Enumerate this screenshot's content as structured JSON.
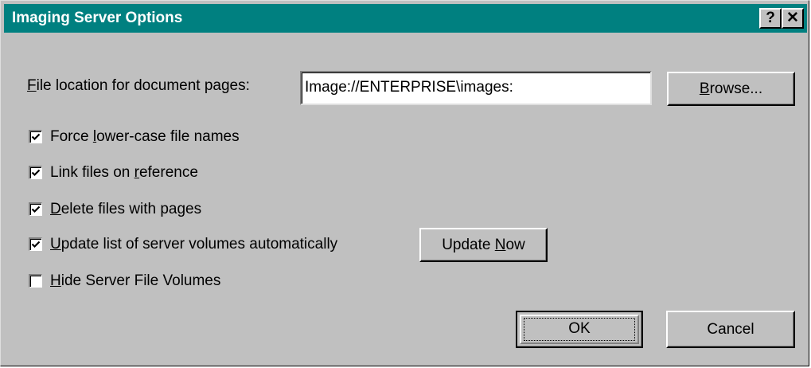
{
  "window": {
    "title": "Imaging Server Options",
    "help_glyph": "?",
    "close_glyph": "✕"
  },
  "file_location": {
    "label_mnemonic": "F",
    "label_rest": "ile location for document pages:",
    "value": "Image://ENTERPRISE\\images:"
  },
  "buttons": {
    "browse_mnemonic": "B",
    "browse_rest": "rowse...",
    "update_prefix": "Update ",
    "update_mnemonic": "N",
    "update_rest": "ow",
    "ok": "OK",
    "cancel": "Cancel"
  },
  "options": [
    {
      "pre": "Force ",
      "mnemonic": "l",
      "post": "ower-case file names",
      "checked": true
    },
    {
      "pre": "Link files on ",
      "mnemonic": "r",
      "post": "eference",
      "checked": true
    },
    {
      "pre": "",
      "mnemonic": "D",
      "post": "elete files with pages",
      "checked": true
    },
    {
      "pre": "",
      "mnemonic": "U",
      "post": "pdate list of server volumes automatically",
      "checked": true
    },
    {
      "pre": "",
      "mnemonic": "H",
      "post": "ide Server File Volumes",
      "checked": false
    }
  ],
  "colors": {
    "titlebar": "#008080",
    "face": "#c0c0c0"
  }
}
